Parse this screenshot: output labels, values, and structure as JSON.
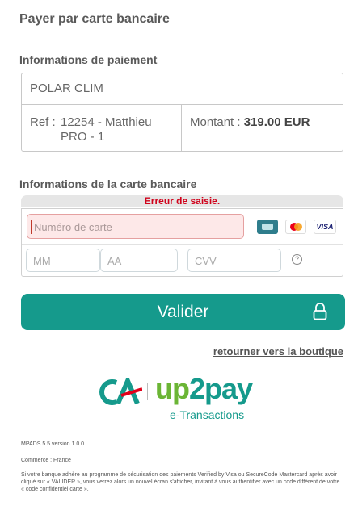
{
  "page": {
    "title": "Payer par carte bancaire"
  },
  "payment_info": {
    "section_title": "Informations de paiement",
    "merchant": "POLAR CLIM",
    "ref_label": "Ref :",
    "ref_value": "12254 - Matthieu PRO - 1",
    "amount_label": "Montant :",
    "amount_value": "319.00 EUR"
  },
  "card_info": {
    "section_title": "Informations de la carte bancaire",
    "error": "Erreur de saisie.",
    "card_number_placeholder": "Numéro de carte",
    "month_placeholder": "MM",
    "year_placeholder": "AA",
    "cvv_placeholder": "CVV",
    "help_symbol": "?",
    "brands": [
      "cb-icon",
      "mastercard-icon",
      "visa-icon"
    ],
    "visa_label": "VISA"
  },
  "actions": {
    "submit_label": "Valider",
    "back_link": "retourner vers la boutique"
  },
  "branding": {
    "up_text": "up",
    "pay_text": "2pay",
    "tagline": "e-Transactions"
  },
  "footer": {
    "version": "MPADS 5.5 version 1.0.0",
    "commerce": "Commerce : France",
    "notice": "Si votre banque adhère au programme de sécurisation des paiements Verified by Visa ou SecureCode Mastercard après avoir cliqué sur « VALIDER », vous verrez alors un nouvel écran s'afficher, invitant à vous authentifier avec un code différent de votre « code confidentiel carte »."
  },
  "colors": {
    "accent": "#159a8c",
    "error": "#d0021b",
    "green": "#6bb535"
  }
}
